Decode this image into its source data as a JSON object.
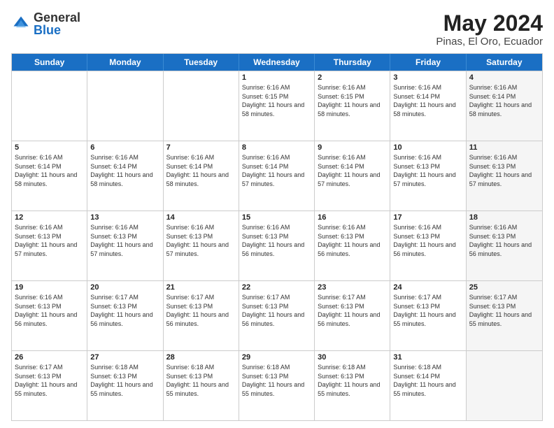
{
  "logo": {
    "general": "General",
    "blue": "Blue"
  },
  "title": {
    "month": "May 2024",
    "location": "Pinas, El Oro, Ecuador"
  },
  "weekdays": [
    "Sunday",
    "Monday",
    "Tuesday",
    "Wednesday",
    "Thursday",
    "Friday",
    "Saturday"
  ],
  "rows": [
    [
      {
        "day": "",
        "sunrise": "",
        "sunset": "",
        "daylight": "",
        "shaded": false
      },
      {
        "day": "",
        "sunrise": "",
        "sunset": "",
        "daylight": "",
        "shaded": false
      },
      {
        "day": "",
        "sunrise": "",
        "sunset": "",
        "daylight": "",
        "shaded": false
      },
      {
        "day": "1",
        "sunrise": "Sunrise: 6:16 AM",
        "sunset": "Sunset: 6:15 PM",
        "daylight": "Daylight: 11 hours and 58 minutes.",
        "shaded": false
      },
      {
        "day": "2",
        "sunrise": "Sunrise: 6:16 AM",
        "sunset": "Sunset: 6:15 PM",
        "daylight": "Daylight: 11 hours and 58 minutes.",
        "shaded": false
      },
      {
        "day": "3",
        "sunrise": "Sunrise: 6:16 AM",
        "sunset": "Sunset: 6:14 PM",
        "daylight": "Daylight: 11 hours and 58 minutes.",
        "shaded": false
      },
      {
        "day": "4",
        "sunrise": "Sunrise: 6:16 AM",
        "sunset": "Sunset: 6:14 PM",
        "daylight": "Daylight: 11 hours and 58 minutes.",
        "shaded": true
      }
    ],
    [
      {
        "day": "5",
        "sunrise": "Sunrise: 6:16 AM",
        "sunset": "Sunset: 6:14 PM",
        "daylight": "Daylight: 11 hours and 58 minutes.",
        "shaded": false
      },
      {
        "day": "6",
        "sunrise": "Sunrise: 6:16 AM",
        "sunset": "Sunset: 6:14 PM",
        "daylight": "Daylight: 11 hours and 58 minutes.",
        "shaded": false
      },
      {
        "day": "7",
        "sunrise": "Sunrise: 6:16 AM",
        "sunset": "Sunset: 6:14 PM",
        "daylight": "Daylight: 11 hours and 58 minutes.",
        "shaded": false
      },
      {
        "day": "8",
        "sunrise": "Sunrise: 6:16 AM",
        "sunset": "Sunset: 6:14 PM",
        "daylight": "Daylight: 11 hours and 57 minutes.",
        "shaded": false
      },
      {
        "day": "9",
        "sunrise": "Sunrise: 6:16 AM",
        "sunset": "Sunset: 6:14 PM",
        "daylight": "Daylight: 11 hours and 57 minutes.",
        "shaded": false
      },
      {
        "day": "10",
        "sunrise": "Sunrise: 6:16 AM",
        "sunset": "Sunset: 6:13 PM",
        "daylight": "Daylight: 11 hours and 57 minutes.",
        "shaded": false
      },
      {
        "day": "11",
        "sunrise": "Sunrise: 6:16 AM",
        "sunset": "Sunset: 6:13 PM",
        "daylight": "Daylight: 11 hours and 57 minutes.",
        "shaded": true
      }
    ],
    [
      {
        "day": "12",
        "sunrise": "Sunrise: 6:16 AM",
        "sunset": "Sunset: 6:13 PM",
        "daylight": "Daylight: 11 hours and 57 minutes.",
        "shaded": false
      },
      {
        "day": "13",
        "sunrise": "Sunrise: 6:16 AM",
        "sunset": "Sunset: 6:13 PM",
        "daylight": "Daylight: 11 hours and 57 minutes.",
        "shaded": false
      },
      {
        "day": "14",
        "sunrise": "Sunrise: 6:16 AM",
        "sunset": "Sunset: 6:13 PM",
        "daylight": "Daylight: 11 hours and 57 minutes.",
        "shaded": false
      },
      {
        "day": "15",
        "sunrise": "Sunrise: 6:16 AM",
        "sunset": "Sunset: 6:13 PM",
        "daylight": "Daylight: 11 hours and 56 minutes.",
        "shaded": false
      },
      {
        "day": "16",
        "sunrise": "Sunrise: 6:16 AM",
        "sunset": "Sunset: 6:13 PM",
        "daylight": "Daylight: 11 hours and 56 minutes.",
        "shaded": false
      },
      {
        "day": "17",
        "sunrise": "Sunrise: 6:16 AM",
        "sunset": "Sunset: 6:13 PM",
        "daylight": "Daylight: 11 hours and 56 minutes.",
        "shaded": false
      },
      {
        "day": "18",
        "sunrise": "Sunrise: 6:16 AM",
        "sunset": "Sunset: 6:13 PM",
        "daylight": "Daylight: 11 hours and 56 minutes.",
        "shaded": true
      }
    ],
    [
      {
        "day": "19",
        "sunrise": "Sunrise: 6:16 AM",
        "sunset": "Sunset: 6:13 PM",
        "daylight": "Daylight: 11 hours and 56 minutes.",
        "shaded": false
      },
      {
        "day": "20",
        "sunrise": "Sunrise: 6:17 AM",
        "sunset": "Sunset: 6:13 PM",
        "daylight": "Daylight: 11 hours and 56 minutes.",
        "shaded": false
      },
      {
        "day": "21",
        "sunrise": "Sunrise: 6:17 AM",
        "sunset": "Sunset: 6:13 PM",
        "daylight": "Daylight: 11 hours and 56 minutes.",
        "shaded": false
      },
      {
        "day": "22",
        "sunrise": "Sunrise: 6:17 AM",
        "sunset": "Sunset: 6:13 PM",
        "daylight": "Daylight: 11 hours and 56 minutes.",
        "shaded": false
      },
      {
        "day": "23",
        "sunrise": "Sunrise: 6:17 AM",
        "sunset": "Sunset: 6:13 PM",
        "daylight": "Daylight: 11 hours and 56 minutes.",
        "shaded": false
      },
      {
        "day": "24",
        "sunrise": "Sunrise: 6:17 AM",
        "sunset": "Sunset: 6:13 PM",
        "daylight": "Daylight: 11 hours and 55 minutes.",
        "shaded": false
      },
      {
        "day": "25",
        "sunrise": "Sunrise: 6:17 AM",
        "sunset": "Sunset: 6:13 PM",
        "daylight": "Daylight: 11 hours and 55 minutes.",
        "shaded": true
      }
    ],
    [
      {
        "day": "26",
        "sunrise": "Sunrise: 6:17 AM",
        "sunset": "Sunset: 6:13 PM",
        "daylight": "Daylight: 11 hours and 55 minutes.",
        "shaded": false
      },
      {
        "day": "27",
        "sunrise": "Sunrise: 6:18 AM",
        "sunset": "Sunset: 6:13 PM",
        "daylight": "Daylight: 11 hours and 55 minutes.",
        "shaded": false
      },
      {
        "day": "28",
        "sunrise": "Sunrise: 6:18 AM",
        "sunset": "Sunset: 6:13 PM",
        "daylight": "Daylight: 11 hours and 55 minutes.",
        "shaded": false
      },
      {
        "day": "29",
        "sunrise": "Sunrise: 6:18 AM",
        "sunset": "Sunset: 6:13 PM",
        "daylight": "Daylight: 11 hours and 55 minutes.",
        "shaded": false
      },
      {
        "day": "30",
        "sunrise": "Sunrise: 6:18 AM",
        "sunset": "Sunset: 6:13 PM",
        "daylight": "Daylight: 11 hours and 55 minutes.",
        "shaded": false
      },
      {
        "day": "31",
        "sunrise": "Sunrise: 6:18 AM",
        "sunset": "Sunset: 6:14 PM",
        "daylight": "Daylight: 11 hours and 55 minutes.",
        "shaded": false
      },
      {
        "day": "",
        "sunrise": "",
        "sunset": "",
        "daylight": "",
        "shaded": true
      }
    ]
  ]
}
